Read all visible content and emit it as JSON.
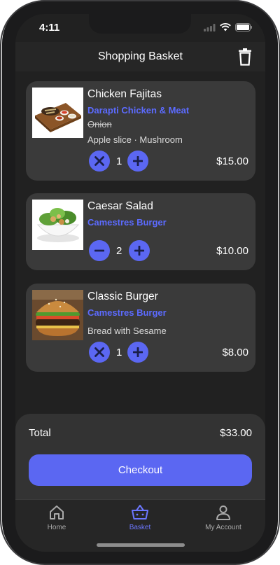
{
  "status": {
    "time": "4:11"
  },
  "header": {
    "title": "Shopping Basket"
  },
  "items": [
    {
      "name": "Chicken Fajitas",
      "restaurant": "Darapti Chicken & Meat",
      "removed": "Onion",
      "options": "Apple slice · Mushroom",
      "quantity": "1",
      "price": "$15.00",
      "decrement": "remove"
    },
    {
      "name": "Caesar Salad",
      "restaurant": "Camestres Burger",
      "quantity": "2",
      "price": "$10.00",
      "decrement": "minus"
    },
    {
      "name": "Classic Burger",
      "restaurant": "Camestres Burger",
      "options": "Bread with Sesame",
      "quantity": "1",
      "price": "$8.00",
      "decrement": "remove"
    }
  ],
  "summary": {
    "total_label": "Total",
    "total_value": "$33.00",
    "checkout_label": "Checkout"
  },
  "tabs": [
    {
      "label": "Home",
      "icon": "home-icon"
    },
    {
      "label": "Basket",
      "icon": "basket-icon",
      "active": true
    },
    {
      "label": "My Account",
      "icon": "account-icon"
    }
  ],
  "colors": {
    "accent": "#5b67f2",
    "background": "#212121",
    "card": "#3a3a3a"
  }
}
